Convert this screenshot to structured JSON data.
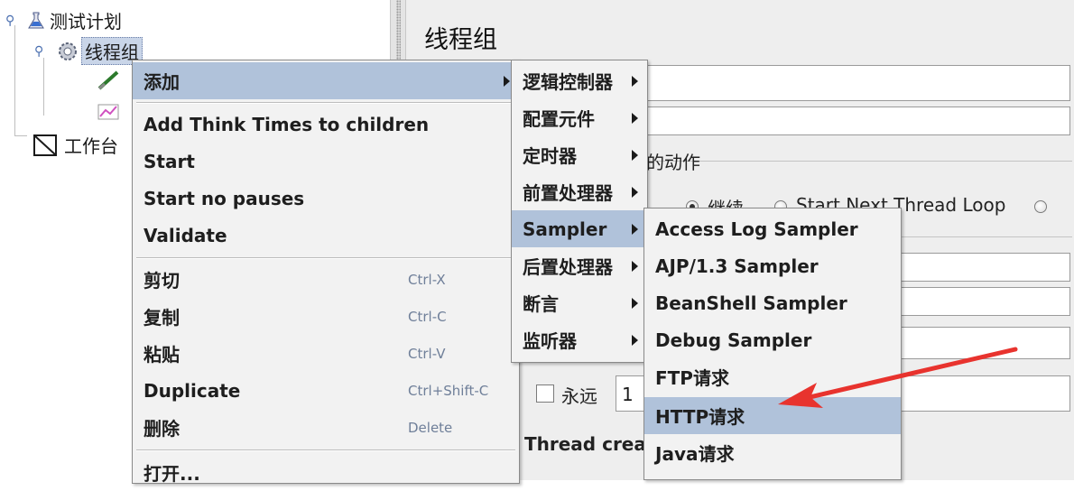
{
  "tree": {
    "items": [
      {
        "label": "测试计划",
        "icon": "flask-icon"
      },
      {
        "label": "线程组",
        "icon": "gear-icon"
      },
      {
        "label": "",
        "icon": "pipette-icon"
      },
      {
        "label": "",
        "icon": "graph-icon"
      },
      {
        "label": "工作台",
        "icon": "workbench-icon"
      }
    ]
  },
  "right_panel": {
    "title": "线程组",
    "action_group_label": "的动作",
    "radio_continue": "继续",
    "radio_next_loop": "Start Next Thread Loop",
    "forever_label": "永远",
    "loop_value": "1",
    "thread_creation": "Thread creat"
  },
  "context_menu": {
    "items": [
      {
        "label": "添加",
        "shortcut": "",
        "submenu": true,
        "highlighted": true
      },
      {
        "label": "Add Think Times to children",
        "shortcut": "",
        "submenu": false
      },
      {
        "label": "Start",
        "shortcut": "",
        "submenu": false
      },
      {
        "label": "Start no pauses",
        "shortcut": "",
        "submenu": false
      },
      {
        "label": "Validate",
        "shortcut": "",
        "submenu": false
      },
      {
        "label": "剪切",
        "shortcut": "Ctrl-X",
        "submenu": false
      },
      {
        "label": "复制",
        "shortcut": "Ctrl-C",
        "submenu": false
      },
      {
        "label": "粘贴",
        "shortcut": "Ctrl-V",
        "submenu": false
      },
      {
        "label": "Duplicate",
        "shortcut": "Ctrl+Shift-C",
        "submenu": false
      },
      {
        "label": "删除",
        "shortcut": "Delete",
        "submenu": false
      },
      {
        "label": "打开...",
        "shortcut": "",
        "submenu": false
      }
    ]
  },
  "add_submenu": {
    "items": [
      {
        "label": "逻辑控制器",
        "submenu": true
      },
      {
        "label": "配置元件",
        "submenu": true
      },
      {
        "label": "定时器",
        "submenu": true
      },
      {
        "label": "前置处理器",
        "submenu": true
      },
      {
        "label": "Sampler",
        "submenu": true,
        "highlighted": true
      },
      {
        "label": "后置处理器",
        "submenu": true
      },
      {
        "label": "断言",
        "submenu": true
      },
      {
        "label": "监听器",
        "submenu": true
      }
    ]
  },
  "sampler_submenu": {
    "items": [
      {
        "label": "Access Log Sampler"
      },
      {
        "label": "AJP/1.3 Sampler"
      },
      {
        "label": "BeanShell Sampler"
      },
      {
        "label": "Debug Sampler"
      },
      {
        "label": "FTP请求"
      },
      {
        "label": "HTTP请求",
        "highlighted": true
      },
      {
        "label": "Java请求"
      }
    ]
  },
  "colors": {
    "menu_highlight": "#b0c2da",
    "annotation_arrow": "#e8332e",
    "shortcut_text": "#6f7f99"
  }
}
